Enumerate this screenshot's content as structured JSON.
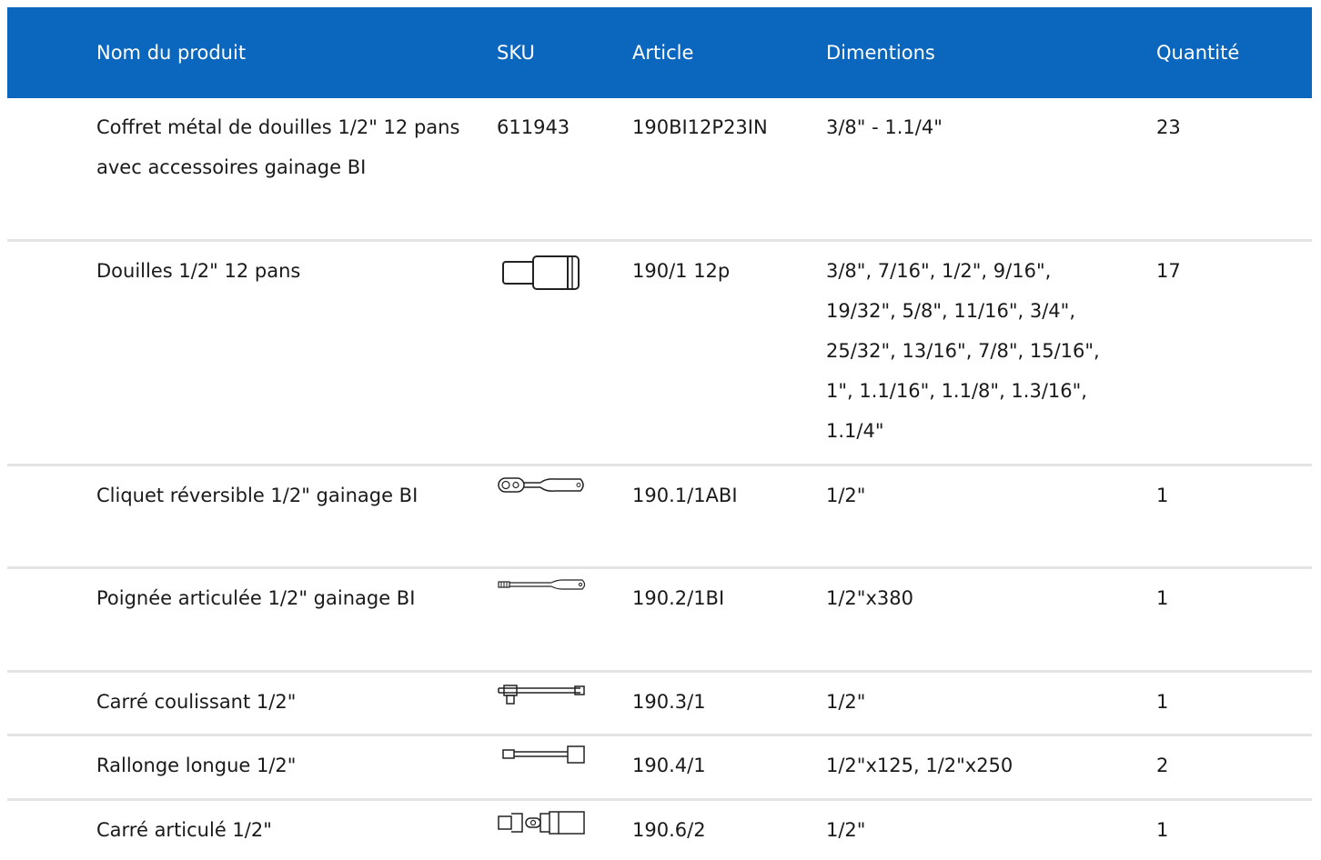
{
  "header": {
    "name": "Nom du produit",
    "sku": "SKU",
    "article": "Article",
    "dimensions": "Dimentions",
    "quantity": "Quantité"
  },
  "rows": [
    {
      "name": "Coffret métal de douilles 1/2\" 12 pans avec accessoires gainage BI",
      "sku": "611943",
      "icon": null,
      "article": "190BI12P23IN",
      "dimensions": "3/8\" - 1.1/4\"",
      "quantity": "23"
    },
    {
      "name": "Douilles 1/2\" 12 pans",
      "sku": "",
      "icon": "socket-icon",
      "article": "190/1 12p",
      "dimensions": "3/8\", 7/16\", 1/2\", 9/16\", 19/32\", 5/8\", 11/16\", 3/4\", 25/32\", 13/16\", 7/8\", 15/16\", 1\", 1.1/16\", 1.1/8\", 1.3/16\", 1.1/4\"",
      "quantity": "17"
    },
    {
      "name": "Cliquet réversible 1/2\" gainage BI",
      "sku": "",
      "icon": "ratchet-icon",
      "article": "190.1/1ABI",
      "dimensions": "1/2\"",
      "quantity": "1"
    },
    {
      "name": "Poignée articulée 1/2\" gainage BI",
      "sku": "",
      "icon": "breaker-bar-icon",
      "article": "190.2/1BI",
      "dimensions": "1/2\"x380",
      "quantity": "1"
    },
    {
      "name": "Carré coulissant 1/2\"",
      "sku": "",
      "icon": "sliding-t-bar-icon",
      "article": "190.3/1",
      "dimensions": "1/2\"",
      "quantity": "1"
    },
    {
      "name": "Rallonge longue 1/2\"",
      "sku": "",
      "icon": "extension-bar-icon",
      "article": "190.4/1",
      "dimensions": "1/2\"x125, 1/2\"x250",
      "quantity": "2"
    },
    {
      "name": "Carré articulé 1/2\"",
      "sku": "",
      "icon": "universal-joint-icon",
      "article": "190.6/2",
      "dimensions": "1/2\"",
      "quantity": "1"
    }
  ],
  "colors": {
    "header_bg": "#0b66be",
    "header_text": "#ffffff",
    "row_divider": "#e4e4e4"
  }
}
